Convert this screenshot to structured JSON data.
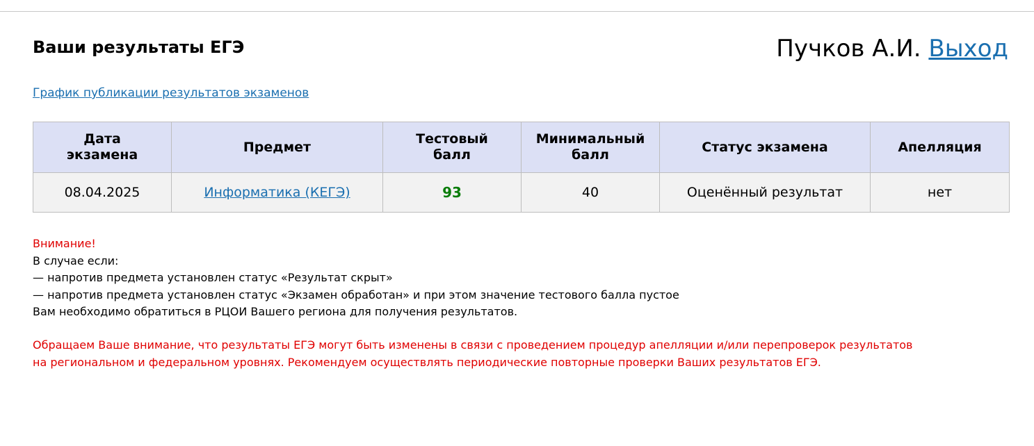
{
  "header": {
    "title": "Ваши результаты ЕГЭ",
    "user_name": "Пучков А.И.",
    "logout_label": "Выход"
  },
  "schedule_link": "График публикации результатов экзаменов",
  "table": {
    "columns": [
      {
        "line1": "Дата",
        "line2": "экзамена"
      },
      {
        "line1": "Предмет",
        "line2": ""
      },
      {
        "line1": "Тестовый",
        "line2": "балл"
      },
      {
        "line1": "Минимальный",
        "line2": "балл"
      },
      {
        "line1": "Статус экзамена",
        "line2": ""
      },
      {
        "line1": "Апелляция",
        "line2": ""
      }
    ],
    "rows": [
      {
        "date": "08.04.2025",
        "subject": "Информатика (КЕГЭ)",
        "score": "93",
        "min_score": "40",
        "status": "Оценённый результат",
        "appeal": "нет"
      }
    ]
  },
  "notice": {
    "attention": "Внимание!",
    "intro": "В случае если:",
    "item1": "— напротив предмета установлен статус «Результат скрыт»",
    "item2": "— напротив предмета установлен статус «Экзамен обработан» и при этом значение тестового балла пустое",
    "conclusion": "Вам необходимо обратиться в РЦОИ Вашего региона для получения результатов."
  },
  "footnote": {
    "line1": "Обращаем Ваше внимание, что результаты ЕГЭ могут быть изменены в связи с проведением процедур апелляции и/или перепроверок результатов",
    "line2": "на региональном и федеральном уровнях. Рекомендуем осуществлять периодические повторные проверки Ваших результатов ЕГЭ."
  },
  "colors": {
    "link": "#1a6fb0",
    "warning": "#e00000",
    "score_pass": "#0b7d0b",
    "header_bg": "#dce0f5",
    "row_bg": "#f2f2f2"
  }
}
